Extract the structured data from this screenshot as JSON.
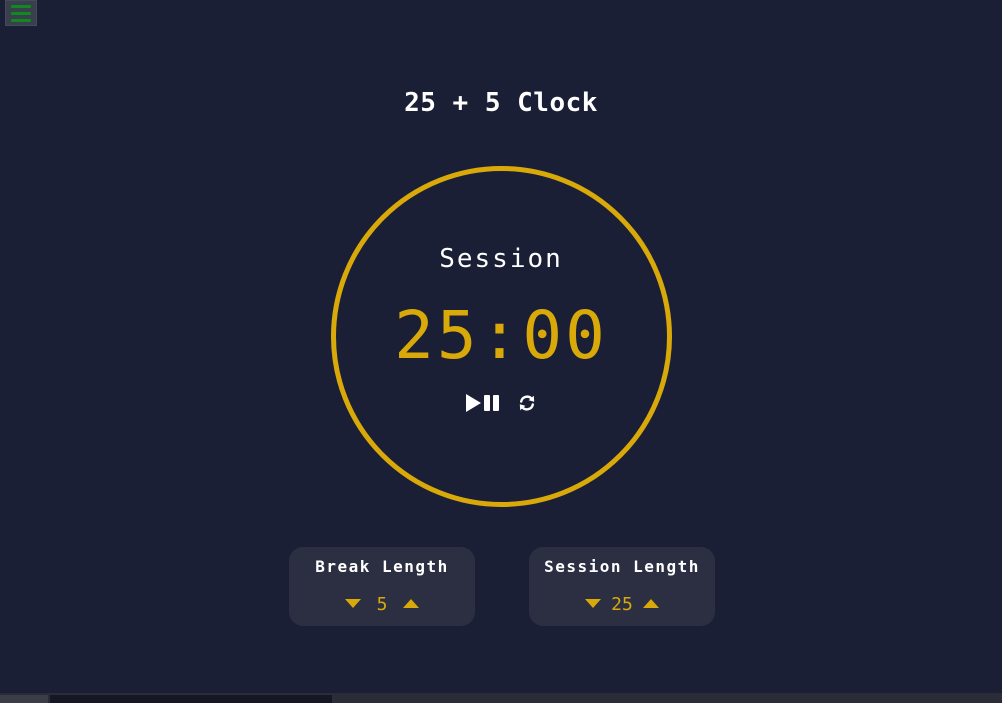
{
  "menu": {
    "icon": "hamburger-icon",
    "color": "#0e8a1e"
  },
  "app": {
    "title": "25 + 5 Clock"
  },
  "timer": {
    "label": "Session",
    "time_left": "25:00",
    "ring_color": "#d9a90a",
    "start_stop_icon": "play-pause-icon",
    "reset_icon": "refresh-icon"
  },
  "break": {
    "label": "Break Length",
    "value": "5",
    "decrement_icon": "caret-down-icon",
    "increment_icon": "caret-up-icon"
  },
  "session": {
    "label": "Session Length",
    "value": "25",
    "decrement_icon": "caret-down-icon",
    "increment_icon": "caret-up-icon"
  },
  "colors": {
    "background": "#1b1f36",
    "accent": "#d9a90a",
    "panel": "#2c2f42"
  }
}
